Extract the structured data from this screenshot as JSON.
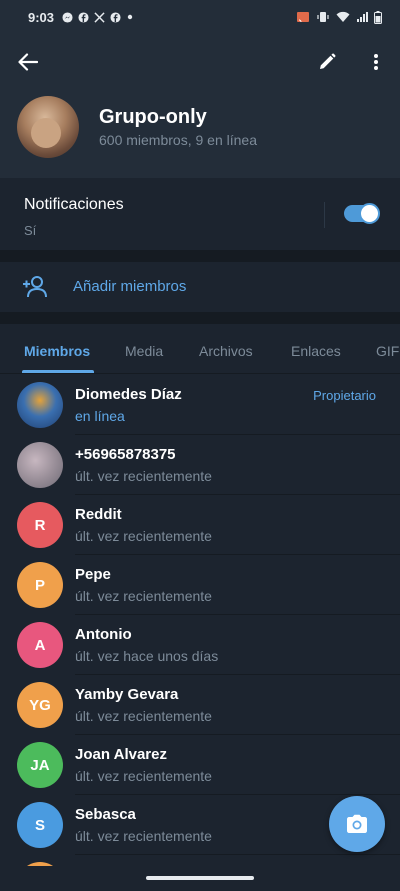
{
  "status_bar": {
    "time": "9:03",
    "left_icons": [
      "messenger-icon",
      "facebook-icon",
      "x-icon",
      "facebook-icon",
      "dot-icon"
    ],
    "right_icons": [
      "cast-icon",
      "vibrate-icon",
      "wifi-icon",
      "signal-icon",
      "battery-icon"
    ]
  },
  "header": {
    "group_name": "Grupo-only",
    "subtitle": "600 miembros, 9 en línea"
  },
  "notifications": {
    "title": "Notificaciones",
    "value": "Sí",
    "enabled": true
  },
  "add_members": {
    "label": "Añadir miembros"
  },
  "tabs": [
    {
      "label": "Miembros",
      "active": true
    },
    {
      "label": "Media",
      "active": false
    },
    {
      "label": "Archivos",
      "active": false
    },
    {
      "label": "Enlaces",
      "active": false
    },
    {
      "label": "GIF",
      "active": false
    }
  ],
  "members": [
    {
      "name": "Diomedes Díaz",
      "status": "en línea",
      "role": "Propietario",
      "initials": "",
      "color": "#3a6fb0"
    },
    {
      "name": "+56965878375",
      "status": "últ. vez recientemente",
      "role": "",
      "initials": "",
      "color": "#9a8f99"
    },
    {
      "name": "Reddit",
      "status": "últ. vez recientemente",
      "role": "",
      "initials": "R",
      "color": "#e65a5f"
    },
    {
      "name": "Pepe",
      "status": "últ. vez recientemente",
      "role": "",
      "initials": "P",
      "color": "#f0a04b"
    },
    {
      "name": "Antonio",
      "status": "últ. vez hace unos días",
      "role": "",
      "initials": "A",
      "color": "#e8577e"
    },
    {
      "name": "Yamby Gevara",
      "status": "últ. vez recientemente",
      "role": "",
      "initials": "YG",
      "color": "#f0a04b"
    },
    {
      "name": "Joan Alvarez",
      "status": "últ. vez recientemente",
      "role": "",
      "initials": "JA",
      "color": "#4cbb5c"
    },
    {
      "name": "Sebasca",
      "status": "últ. vez recientemente",
      "role": "",
      "initials": "S",
      "color": "#4a9be0"
    }
  ],
  "fab": {
    "icon": "camera-icon"
  },
  "colors": {
    "accent": "#5fa8e8",
    "background": "#1c242f",
    "header_background": "#232d39",
    "secondary_text": "#7d8b99"
  }
}
